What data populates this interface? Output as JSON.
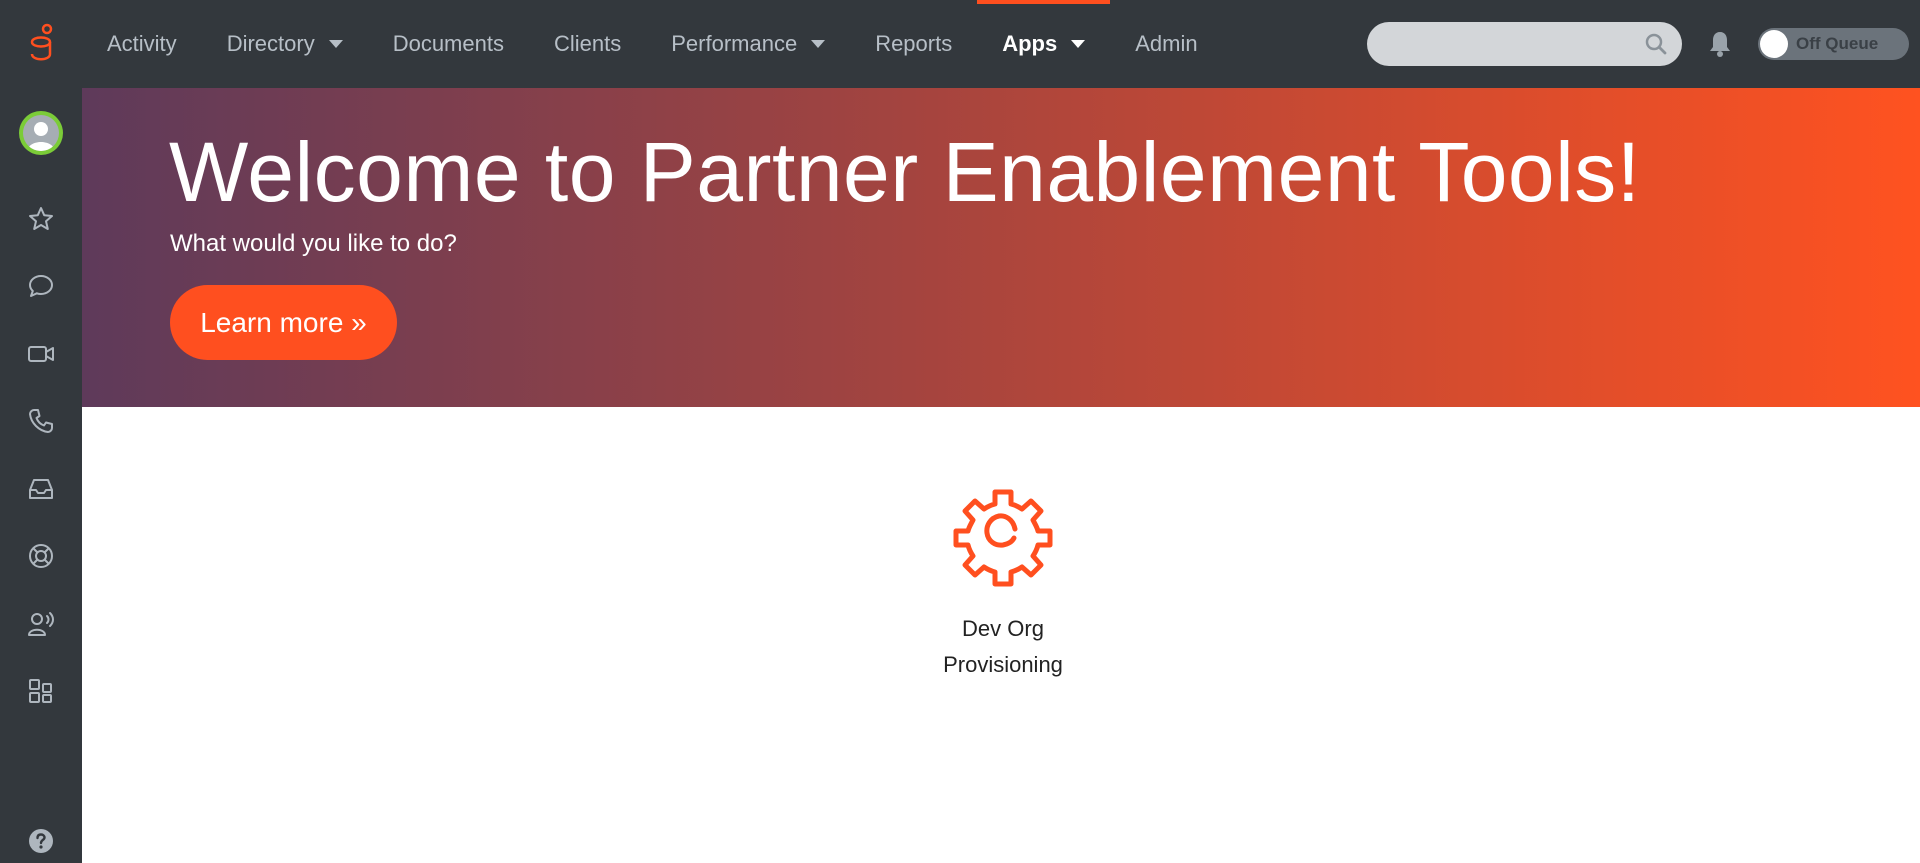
{
  "colors": {
    "accent": "#ff4f1f",
    "topbar_bg": "#33383d",
    "avatar_ring": "#7bcc38"
  },
  "header": {
    "logo_icon": "genesys-logo-icon",
    "nav": [
      {
        "label": "Activity",
        "dropdown": false,
        "active": false
      },
      {
        "label": "Directory",
        "dropdown": true,
        "active": false
      },
      {
        "label": "Documents",
        "dropdown": false,
        "active": false
      },
      {
        "label": "Clients",
        "dropdown": false,
        "active": false
      },
      {
        "label": "Performance",
        "dropdown": true,
        "active": false
      },
      {
        "label": "Reports",
        "dropdown": false,
        "active": false
      },
      {
        "label": "Apps",
        "dropdown": true,
        "active": true
      },
      {
        "label": "Admin",
        "dropdown": false,
        "active": false
      }
    ],
    "search": {
      "placeholder": "",
      "value": "",
      "icon": "search-icon"
    },
    "notification_icon": "bell-icon",
    "queue_toggle": {
      "label": "Off Queue",
      "on": false
    }
  },
  "sidebar": {
    "items": [
      {
        "icon": "avatar"
      },
      {
        "icon": "star-icon"
      },
      {
        "icon": "chat-icon"
      },
      {
        "icon": "video-icon"
      },
      {
        "icon": "phone-icon"
      },
      {
        "icon": "inbox-icon"
      },
      {
        "icon": "lifebuoy-icon"
      },
      {
        "icon": "agent-voice-icon"
      },
      {
        "icon": "apps-grid-icon"
      },
      {
        "icon": "help-icon"
      }
    ]
  },
  "hero": {
    "title": "Welcome to Partner Enablement Tools!",
    "subtitle": "What would you like to do?",
    "button_label": "Learn more »"
  },
  "apps": [
    {
      "label_line1": "Dev Org",
      "label_line2": "Provisioning",
      "icon": "gear-icon"
    }
  ]
}
